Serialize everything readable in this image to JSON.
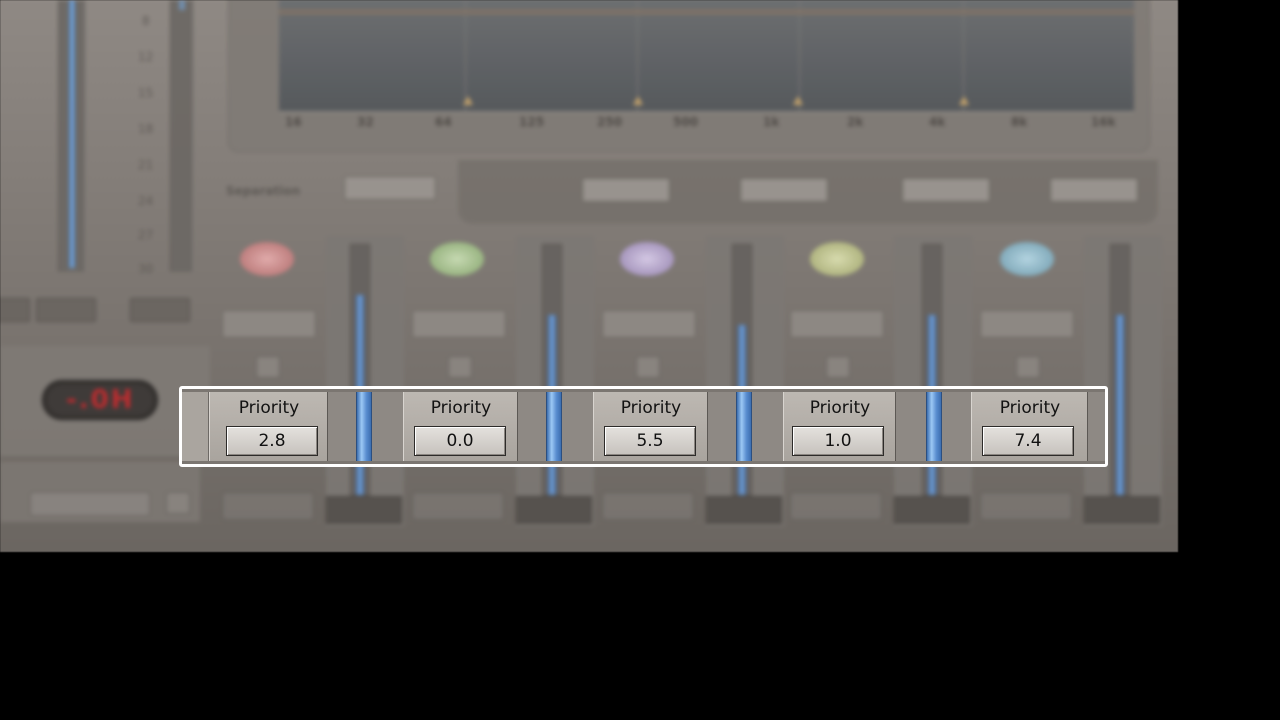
{
  "priority_strip": {
    "bands": [
      {
        "label": "Priority",
        "value": "2.8"
      },
      {
        "label": "Priority",
        "value": "0.0"
      },
      {
        "label": "Priority",
        "value": "5.5"
      },
      {
        "label": "Priority",
        "value": "1.0"
      },
      {
        "label": "Priority",
        "value": "7.4"
      }
    ]
  },
  "colors": {
    "highlight_border": "#ffffff",
    "meter_blue": "#7eaee6",
    "readout_red": "#c2262a",
    "band_knob_colors": [
      "#d48a8a",
      "#9fc08a",
      "#b2a2cc",
      "#b9c08a",
      "#8ab6c8"
    ]
  },
  "icons": [
    "band-knob-icon",
    "solo-button-icon"
  ]
}
